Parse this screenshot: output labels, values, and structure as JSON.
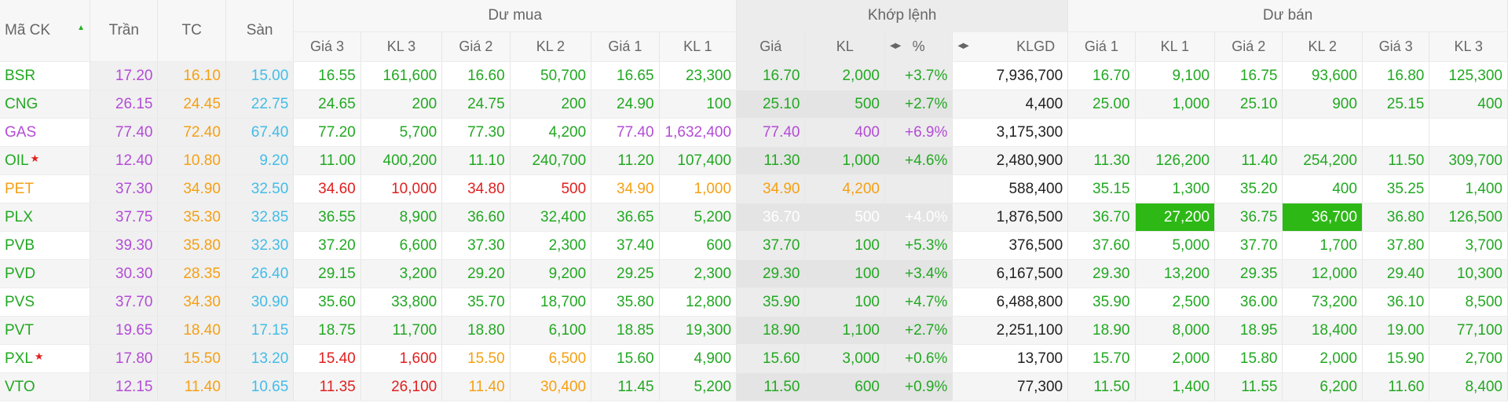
{
  "colors": {
    "up": "#22a822",
    "down": "#e02020",
    "ref": "#f5a014",
    "ceil": "#b34cd6",
    "floor": "#43bce8",
    "highlight_bg": "#2db816"
  },
  "header": {
    "symbol": "Mã CK",
    "ceil": "Trần",
    "ref": "TC",
    "floor": "Sàn",
    "buy_group": "Dư mua",
    "match_group": "Khớp lệnh",
    "sell_group": "Dư bán",
    "buy_cols": [
      "Giá 3",
      "KL 3",
      "Giá 2",
      "KL 2",
      "Giá 1",
      "KL 1"
    ],
    "match_cols": [
      "Giá",
      "KL",
      "%"
    ],
    "klgd": "KLGD",
    "sell_cols": [
      "Giá 1",
      "KL 1",
      "Giá 2",
      "KL 2",
      "Giá 3",
      "KL 3"
    ]
  },
  "rows": [
    {
      "sym": "BSR",
      "star": false,
      "ceil": "17.20",
      "ref": "16.10",
      "floor": "15.00",
      "b3p": "16.55",
      "b3v": "161,600",
      "b2p": "16.60",
      "b2v": "50,700",
      "b1p": "16.65",
      "b1v": "23,300",
      "mp": "16.70",
      "mv": "2,000",
      "pct": "+3.7%",
      "vol": "7,936,700",
      "s1p": "16.70",
      "s1v": "9,100",
      "s2p": "16.75",
      "s2v": "93,600",
      "s3p": "16.80",
      "s3v": "125,300",
      "c": {
        "sym": "up",
        "b3": "up",
        "b2": "up",
        "b1": "up",
        "m": "up",
        "s1": "up",
        "s2": "up",
        "s3": "up"
      }
    },
    {
      "sym": "CNG",
      "star": false,
      "ceil": "26.15",
      "ref": "24.45",
      "floor": "22.75",
      "b3p": "24.65",
      "b3v": "200",
      "b2p": "24.75",
      "b2v": "200",
      "b1p": "24.90",
      "b1v": "100",
      "mp": "25.10",
      "mv": "500",
      "pct": "+2.7%",
      "vol": "4,400",
      "s1p": "25.00",
      "s1v": "1,000",
      "s2p": "25.10",
      "s2v": "900",
      "s3p": "25.15",
      "s3v": "400",
      "c": {
        "sym": "up",
        "b3": "up",
        "b2": "up",
        "b1": "up",
        "m": "up",
        "s1": "up",
        "s2": "up",
        "s3": "up"
      }
    },
    {
      "sym": "GAS",
      "star": false,
      "ceil": "77.40",
      "ref": "72.40",
      "floor": "67.40",
      "b3p": "77.20",
      "b3v": "5,700",
      "b2p": "77.30",
      "b2v": "4,200",
      "b1p": "77.40",
      "b1v": "1,632,400",
      "mp": "77.40",
      "mv": "400",
      "pct": "+6.9%",
      "vol": "3,175,300",
      "s1p": "",
      "s1v": "",
      "s2p": "",
      "s2v": "",
      "s3p": "",
      "s3v": "",
      "c": {
        "sym": "ceil",
        "b3": "up",
        "b2": "up",
        "b1": "ceil",
        "m": "ceil",
        "s1": "up",
        "s2": "up",
        "s3": "up"
      }
    },
    {
      "sym": "OIL",
      "star": true,
      "ceil": "12.40",
      "ref": "10.80",
      "floor": "9.20",
      "b3p": "11.00",
      "b3v": "400,200",
      "b2p": "11.10",
      "b2v": "240,700",
      "b1p": "11.20",
      "b1v": "107,400",
      "mp": "11.30",
      "mv": "1,000",
      "pct": "+4.6%",
      "vol": "2,480,900",
      "s1p": "11.30",
      "s1v": "126,200",
      "s2p": "11.40",
      "s2v": "254,200",
      "s3p": "11.50",
      "s3v": "309,700",
      "c": {
        "sym": "up",
        "b3": "up",
        "b2": "up",
        "b1": "up",
        "m": "up",
        "s1": "up",
        "s2": "up",
        "s3": "up"
      }
    },
    {
      "sym": "PET",
      "star": false,
      "ceil": "37.30",
      "ref": "34.90",
      "floor": "32.50",
      "b3p": "34.60",
      "b3v": "10,000",
      "b2p": "34.80",
      "b2v": "500",
      "b1p": "34.90",
      "b1v": "1,000",
      "mp": "34.90",
      "mv": "4,200",
      "pct": "",
      "vol": "588,400",
      "s1p": "35.15",
      "s1v": "1,300",
      "s2p": "35.20",
      "s2v": "400",
      "s3p": "35.25",
      "s3v": "1,400",
      "c": {
        "sym": "ref",
        "b3": "down",
        "b2": "down",
        "b1": "ref",
        "m": "ref",
        "s1": "up",
        "s2": "up",
        "s3": "up"
      }
    },
    {
      "sym": "PLX",
      "star": false,
      "ceil": "37.75",
      "ref": "35.30",
      "floor": "32.85",
      "b3p": "36.55",
      "b3v": "8,900",
      "b2p": "36.60",
      "b2v": "32,400",
      "b1p": "36.65",
      "b1v": "5,200",
      "mp": "36.70",
      "mv": "500",
      "pct": "+4.0%",
      "vol": "1,876,500",
      "s1p": "36.70",
      "s1v": "27,200",
      "s2p": "36.75",
      "s2v": "36,700",
      "s3p": "36.80",
      "s3v": "126,500",
      "hl": [
        "mp",
        "mv",
        "pct",
        "s1v",
        "s2v"
      ],
      "c": {
        "sym": "up",
        "b3": "up",
        "b2": "up",
        "b1": "up",
        "m": "up",
        "s1": "up",
        "s2": "up",
        "s3": "up"
      }
    },
    {
      "sym": "PVB",
      "star": false,
      "ceil": "39.30",
      "ref": "35.80",
      "floor": "32.30",
      "b3p": "37.20",
      "b3v": "6,600",
      "b2p": "37.30",
      "b2v": "2,300",
      "b1p": "37.40",
      "b1v": "600",
      "mp": "37.70",
      "mv": "100",
      "pct": "+5.3%",
      "vol": "376,500",
      "s1p": "37.60",
      "s1v": "5,000",
      "s2p": "37.70",
      "s2v": "1,700",
      "s3p": "37.80",
      "s3v": "3,700",
      "c": {
        "sym": "up",
        "b3": "up",
        "b2": "up",
        "b1": "up",
        "m": "up",
        "s1": "up",
        "s2": "up",
        "s3": "up"
      }
    },
    {
      "sym": "PVD",
      "star": false,
      "ceil": "30.30",
      "ref": "28.35",
      "floor": "26.40",
      "b3p": "29.15",
      "b3v": "3,200",
      "b2p": "29.20",
      "b2v": "9,200",
      "b1p": "29.25",
      "b1v": "2,300",
      "mp": "29.30",
      "mv": "100",
      "pct": "+3.4%",
      "vol": "6,167,500",
      "s1p": "29.30",
      "s1v": "13,200",
      "s2p": "29.35",
      "s2v": "12,000",
      "s3p": "29.40",
      "s3v": "10,300",
      "c": {
        "sym": "up",
        "b3": "up",
        "b2": "up",
        "b1": "up",
        "m": "up",
        "s1": "up",
        "s2": "up",
        "s3": "up"
      }
    },
    {
      "sym": "PVS",
      "star": false,
      "ceil": "37.70",
      "ref": "34.30",
      "floor": "30.90",
      "b3p": "35.60",
      "b3v": "33,800",
      "b2p": "35.70",
      "b2v": "18,700",
      "b1p": "35.80",
      "b1v": "12,800",
      "mp": "35.90",
      "mv": "100",
      "pct": "+4.7%",
      "vol": "6,488,800",
      "s1p": "35.90",
      "s1v": "2,500",
      "s2p": "36.00",
      "s2v": "73,200",
      "s3p": "36.10",
      "s3v": "8,500",
      "c": {
        "sym": "up",
        "b3": "up",
        "b2": "up",
        "b1": "up",
        "m": "up",
        "s1": "up",
        "s2": "up",
        "s3": "up"
      }
    },
    {
      "sym": "PVT",
      "star": false,
      "ceil": "19.65",
      "ref": "18.40",
      "floor": "17.15",
      "b3p": "18.75",
      "b3v": "11,700",
      "b2p": "18.80",
      "b2v": "6,100",
      "b1p": "18.85",
      "b1v": "19,300",
      "mp": "18.90",
      "mv": "1,100",
      "pct": "+2.7%",
      "vol": "2,251,100",
      "s1p": "18.90",
      "s1v": "8,000",
      "s2p": "18.95",
      "s2v": "18,400",
      "s3p": "19.00",
      "s3v": "77,100",
      "c": {
        "sym": "up",
        "b3": "up",
        "b2": "up",
        "b1": "up",
        "m": "up",
        "s1": "up",
        "s2": "up",
        "s3": "up"
      }
    },
    {
      "sym": "PXL",
      "star": true,
      "ceil": "17.80",
      "ref": "15.50",
      "floor": "13.20",
      "b3p": "15.40",
      "b3v": "1,600",
      "b2p": "15.50",
      "b2v": "6,500",
      "b1p": "15.60",
      "b1v": "4,900",
      "mp": "15.60",
      "mv": "3,000",
      "pct": "+0.6%",
      "vol": "13,700",
      "s1p": "15.70",
      "s1v": "2,000",
      "s2p": "15.80",
      "s2v": "2,000",
      "s3p": "15.90",
      "s3v": "2,700",
      "c": {
        "sym": "up",
        "b3": "down",
        "b2": "ref",
        "b1": "up",
        "m": "up",
        "s1": "up",
        "s2": "up",
        "s3": "up"
      }
    },
    {
      "sym": "VTO",
      "star": false,
      "ceil": "12.15",
      "ref": "11.40",
      "floor": "10.65",
      "b3p": "11.35",
      "b3v": "26,100",
      "b2p": "11.40",
      "b2v": "30,400",
      "b1p": "11.45",
      "b1v": "5,200",
      "mp": "11.50",
      "mv": "600",
      "pct": "+0.9%",
      "vol": "77,300",
      "s1p": "11.50",
      "s1v": "1,400",
      "s2p": "11.55",
      "s2v": "6,200",
      "s3p": "11.60",
      "s3v": "8,400",
      "c": {
        "sym": "up",
        "b3": "down",
        "b2": "ref",
        "b1": "up",
        "m": "up",
        "s1": "up",
        "s2": "up",
        "s3": "up"
      }
    }
  ]
}
